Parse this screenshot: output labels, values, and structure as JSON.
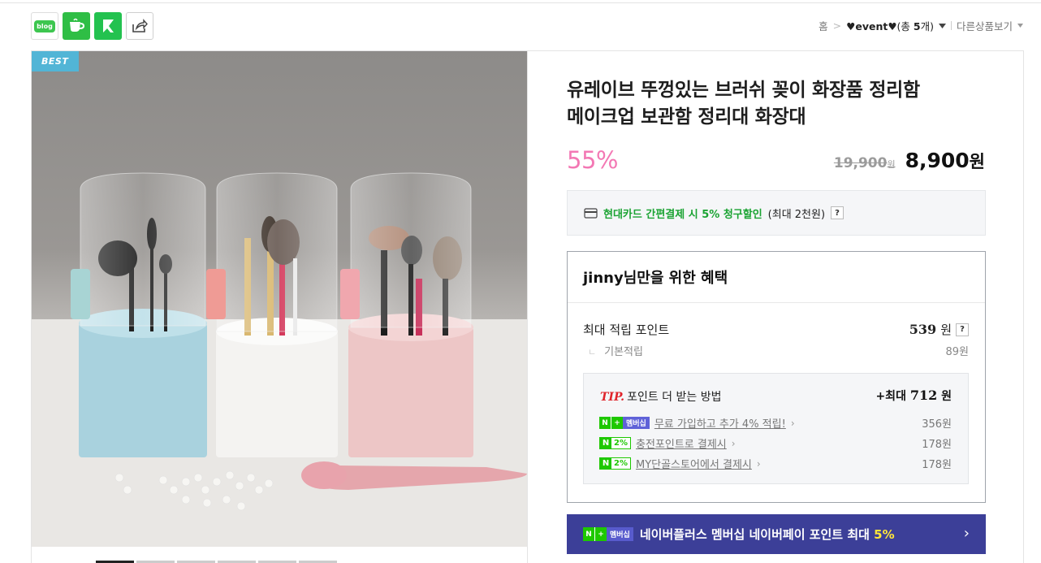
{
  "share": {
    "blog_label": "blog",
    "icons": [
      "blog-icon",
      "cafe-icon",
      "kakaostory-icon",
      "share-icon"
    ]
  },
  "breadcrumb": {
    "home": "홈",
    "separator": ">",
    "category": "♥event♥",
    "count_prefix": "(총 ",
    "count": "5",
    "count_suffix": "개)",
    "more": "다른상품보기"
  },
  "product": {
    "badge": "BEST",
    "title_line1": "유레이브 뚜껑있는 브러쉬 꽂이 화장품 정리함",
    "title_line2": "메이크업 보관함 정리대 화장대",
    "discount": "55%",
    "original_price": "19,900",
    "original_unit": "원",
    "sale_price": "8,900",
    "sale_unit": "원"
  },
  "card_promo": {
    "highlight": "현대카드 간편결제 시 5% 청구할인",
    "note": "(최대 2천원)",
    "help": "?"
  },
  "benefit": {
    "header": "jinny님만을 위한 혜택",
    "max_points_label": "최대 적립 포인트",
    "max_points_value": "539",
    "max_points_unit": "원",
    "help": "?",
    "basic_label": "기본적립",
    "basic_value": "89원",
    "tip": {
      "tip_word": "TIP.",
      "title": "포인트 더 받는 방법",
      "max_prefix": "+최대",
      "max_value": "712",
      "max_unit": "원",
      "rows": [
        {
          "badge": "멤버십",
          "text": "무료 가입하고 추가 4% 적립!",
          "value": "356원"
        },
        {
          "badge": "2%",
          "text": "충전포인트로 결제시",
          "value": "178원"
        },
        {
          "badge": "2%",
          "text": "MY단골스토어에서 결제시",
          "value": "178원"
        }
      ]
    }
  },
  "naver_banner": {
    "badge_n": "N",
    "badge_plus": "+",
    "badge_m": "멤버십",
    "text": "네이버플러스 멤버십 네이버페이 포인트 최대",
    "highlight": "5%",
    "arrow": "›"
  },
  "colors": {
    "discount": "#f378b4",
    "naver_green": "#1ec800",
    "banner_bg": "#3c3f98",
    "best_badge": "#52b5d6",
    "tip_red": "#e0242b"
  }
}
